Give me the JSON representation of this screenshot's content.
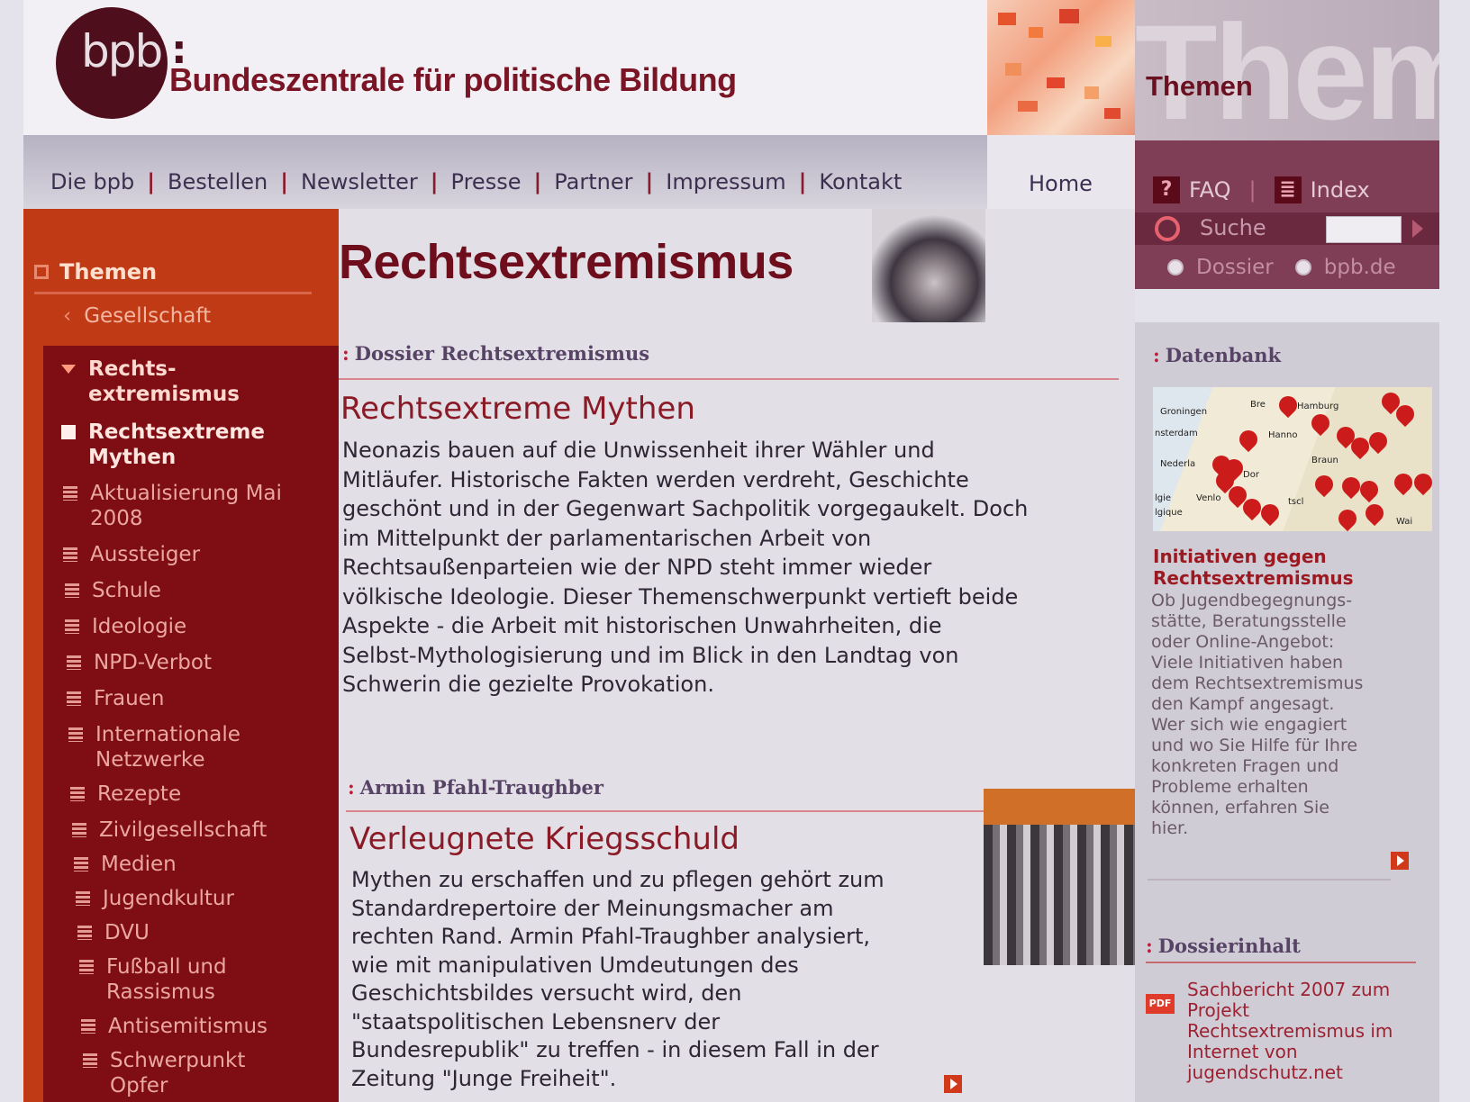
{
  "header": {
    "logo_text": "bpb",
    "logo_colon": ":",
    "org_name": "Bundeszentrale für politische Bildung",
    "themen_label": "Themen",
    "themen_big": "Them"
  },
  "topnav": {
    "items": [
      "Die bpb",
      "Bestellen",
      "Newsletter",
      "Presse",
      "Partner",
      "Impressum",
      "Kontakt"
    ],
    "separator": "|",
    "home": "Home"
  },
  "tools": {
    "faq_icon": "?",
    "faq": "FAQ",
    "separator": "|",
    "index_icon": "≣",
    "index": "Index",
    "search_label": "Suche",
    "search_value": "",
    "radio_dossier": "Dossier",
    "radio_bpb": "bpb.de"
  },
  "sidebar": {
    "head": "Themen",
    "parent": "Gesellschaft",
    "open_item": "Rechts-\nextremismus",
    "items": [
      {
        "label": "Rechtsextreme Mythen",
        "active": true
      },
      {
        "label": "Aktualisierung Mai 2008"
      },
      {
        "label": "Aussteiger"
      },
      {
        "label": "Schule"
      },
      {
        "label": "Ideologie"
      },
      {
        "label": "NPD-Verbot"
      },
      {
        "label": "Frauen"
      },
      {
        "label": "Internationale Netzwerke"
      },
      {
        "label": "Rezepte"
      },
      {
        "label": "Zivilgesellschaft"
      },
      {
        "label": "Medien"
      },
      {
        "label": "Jugendkultur"
      },
      {
        "label": "DVU"
      },
      {
        "label": "Fußball und Rassismus"
      },
      {
        "label": "Antisemitismus"
      },
      {
        "label": "Schwerpunkt Opfer"
      }
    ]
  },
  "main": {
    "title": "Rechtsextremismus",
    "article1": {
      "kicker": "Dossier Rechtsextremismus",
      "title": "Rechtsextreme Mythen",
      "lines": [
        "Neonazis bauen auf die Unwissenheit ihrer Wähler und",
        "Mitläufer. Historische Fakten werden verdreht, Geschichte",
        "geschönt und in der Gegenwart Sachpolitik vorgegaukelt. Doch",
        "im Mittelpunkt der parlamentarischen Arbeit von",
        "Rechtsaußenparteien wie der NPD steht immer wieder",
        "völkische Ideologie. Dieser Themenschwerpunkt vertieft beide",
        "Aspekte - die Arbeit mit historischen Unwahrheiten, die",
        "Selbst-Mythologisierung und im Blick in den Landtag von",
        "Schwerin die gezielte Provokation."
      ]
    },
    "article2": {
      "kicker": "Armin Pfahl-Traughber",
      "title": "Verleugnete Kriegsschuld",
      "lines": [
        "Mythen zu erschaffen und zu pflegen gehört zum",
        "Standardrepertoire der Meinungsmacher am",
        "rechten Rand. Armin Pfahl-Traughber analysiert,",
        "wie mit manipulativen Umdeutungen des",
        "Geschichtsbildes versucht wird, den",
        "\"staatspolitischen Lebensnerv der",
        "Bundesrepublik\" zu treffen - in diesem Fall in der",
        "Zeitung \"Junge Freiheit\"."
      ]
    }
  },
  "right": {
    "db_kicker": "Datenbank",
    "map_labels": [
      "Groningen",
      "Bre",
      "Hamburg",
      "nsterdam",
      "Hanno",
      "Nederla",
      "Braun",
      "Dor",
      "tscl",
      "Wai",
      "lgie",
      "lgique",
      "Venlo"
    ],
    "db_title": "Initiativen gegen Rechtsextremismus",
    "db_lines": [
      "Ob Jugendbegegnungs-",
      "stätte, Beratungsstelle",
      "oder Online-Angebot:",
      "Viele Initiativen haben",
      "dem Rechtsextremismus",
      "den Kampf angesagt.",
      "Wer sich wie engagiert",
      "und wo Sie Hilfe für Ihre",
      "konkreten Fragen und",
      "Probleme erhalten",
      "können, erfahren Sie",
      "hier."
    ],
    "dossier_kicker": "Dossierinhalt",
    "pdf_badge": "PDF",
    "dossier_text": "Sachbericht 2007 zum Projekt Rechtsextremismus im Internet von jugendschutz.net"
  }
}
